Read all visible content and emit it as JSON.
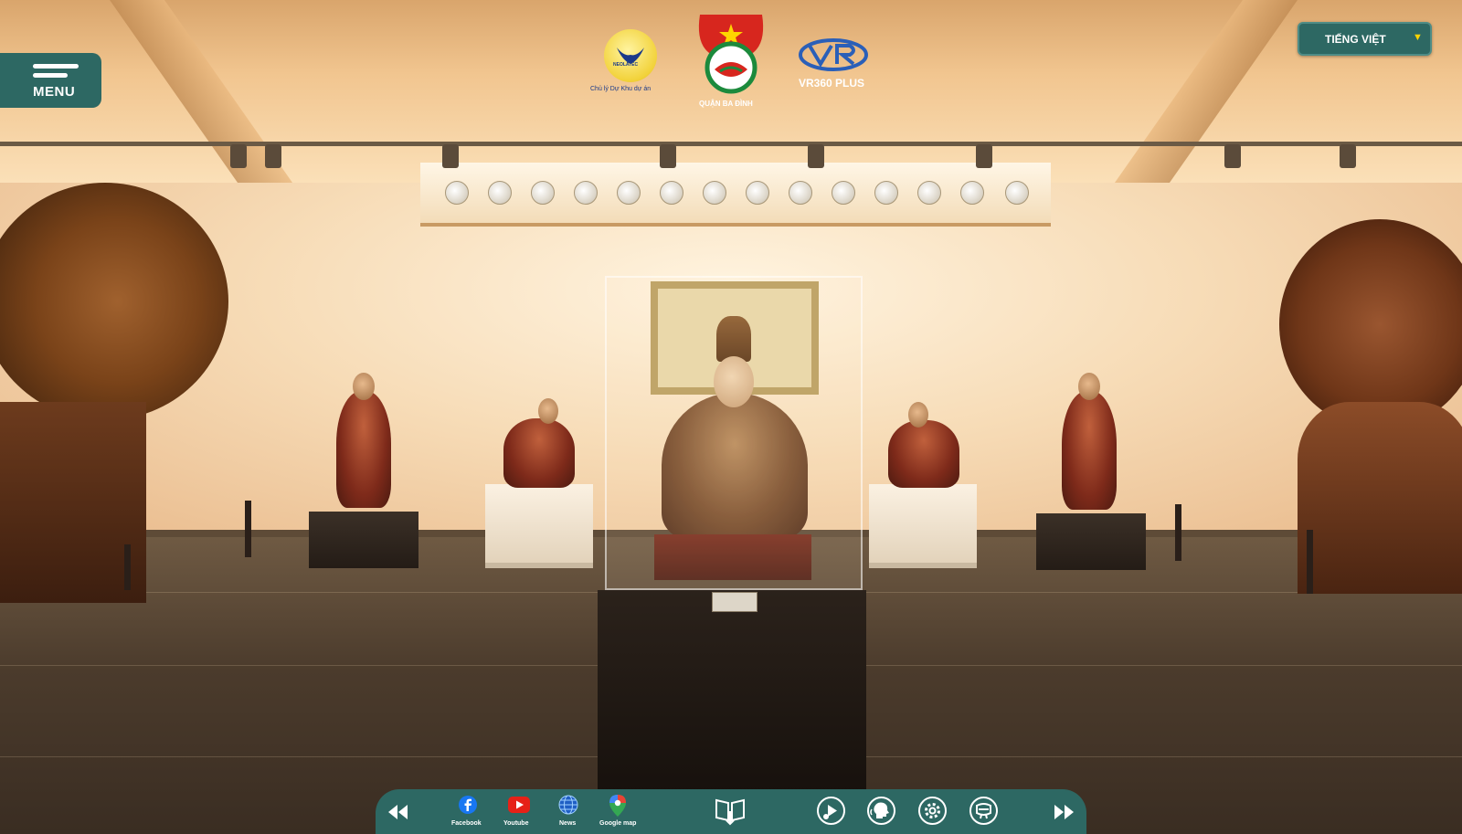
{
  "menu": {
    "label": "MENU"
  },
  "language": {
    "selected": "TIẾNG VIỆT",
    "caret_icon": "triangle-down-icon"
  },
  "logos": {
    "neolatec": {
      "text": "NEOLATEC",
      "caption": "Chủ lý Dự Khu dự án"
    },
    "doan": {
      "caption": "QUẬN BA ĐÌNH"
    },
    "vr360": {
      "caption": "VR360 PLUS"
    }
  },
  "toolbar": {
    "prev_icon": "rewind-icon",
    "social": [
      {
        "label": "Facebook",
        "icon": "facebook-icon"
      },
      {
        "label": "Youtube",
        "icon": "youtube-icon"
      },
      {
        "label": "News",
        "icon": "globe-icon"
      },
      {
        "label": "Google map",
        "icon": "map-pin-icon"
      }
    ],
    "tools": [
      {
        "icon": "guide-book-icon"
      },
      {
        "icon": "audio-guide-icon"
      },
      {
        "icon": "voice-icon"
      },
      {
        "icon": "settings-icon"
      },
      {
        "icon": "vr-headset-icon"
      }
    ],
    "next_icon": "fast-forward-icon"
  },
  "colors": {
    "panel": "#2d6863",
    "accent_caret": "#ffd400"
  }
}
